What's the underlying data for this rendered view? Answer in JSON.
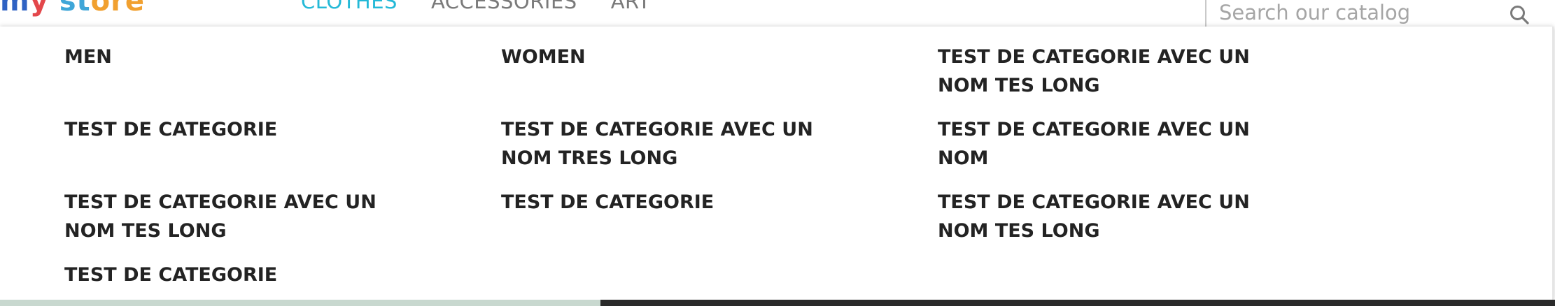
{
  "header": {
    "logo": {
      "part1": "m",
      "part2": "y ",
      "part3": "st",
      "part4": "ore"
    },
    "nav": [
      {
        "label": "CLOTHES",
        "active": true
      },
      {
        "label": "ACCESSORIES",
        "active": false
      },
      {
        "label": "ART",
        "active": false
      }
    ],
    "search": {
      "placeholder": "Search our catalog",
      "icon": "search-icon"
    }
  },
  "menu": {
    "col1": [
      "MEN",
      "TEST DE CATEGORIE",
      "TEST DE CATEGORIE AVEC UN\nNOM TES LONG",
      "TEST DE CATEGORIE"
    ],
    "col2": [
      "WOMEN",
      "TEST DE CATEGORIE AVEC UN\nNOM TRES LONG",
      "TEST DE CATEGORIE"
    ],
    "col3": [
      "TEST DE CATEGORIE AVEC UN\nNOM TES LONG",
      "TEST DE CATEGORIE AVEC UN\nNOM",
      "TEST DE CATEGORIE AVEC UN\nNOM TES LONG"
    ]
  },
  "colors": {
    "active_nav": "#24b9d7",
    "nav": "#7a7a7a",
    "menu_text": "#232323"
  }
}
